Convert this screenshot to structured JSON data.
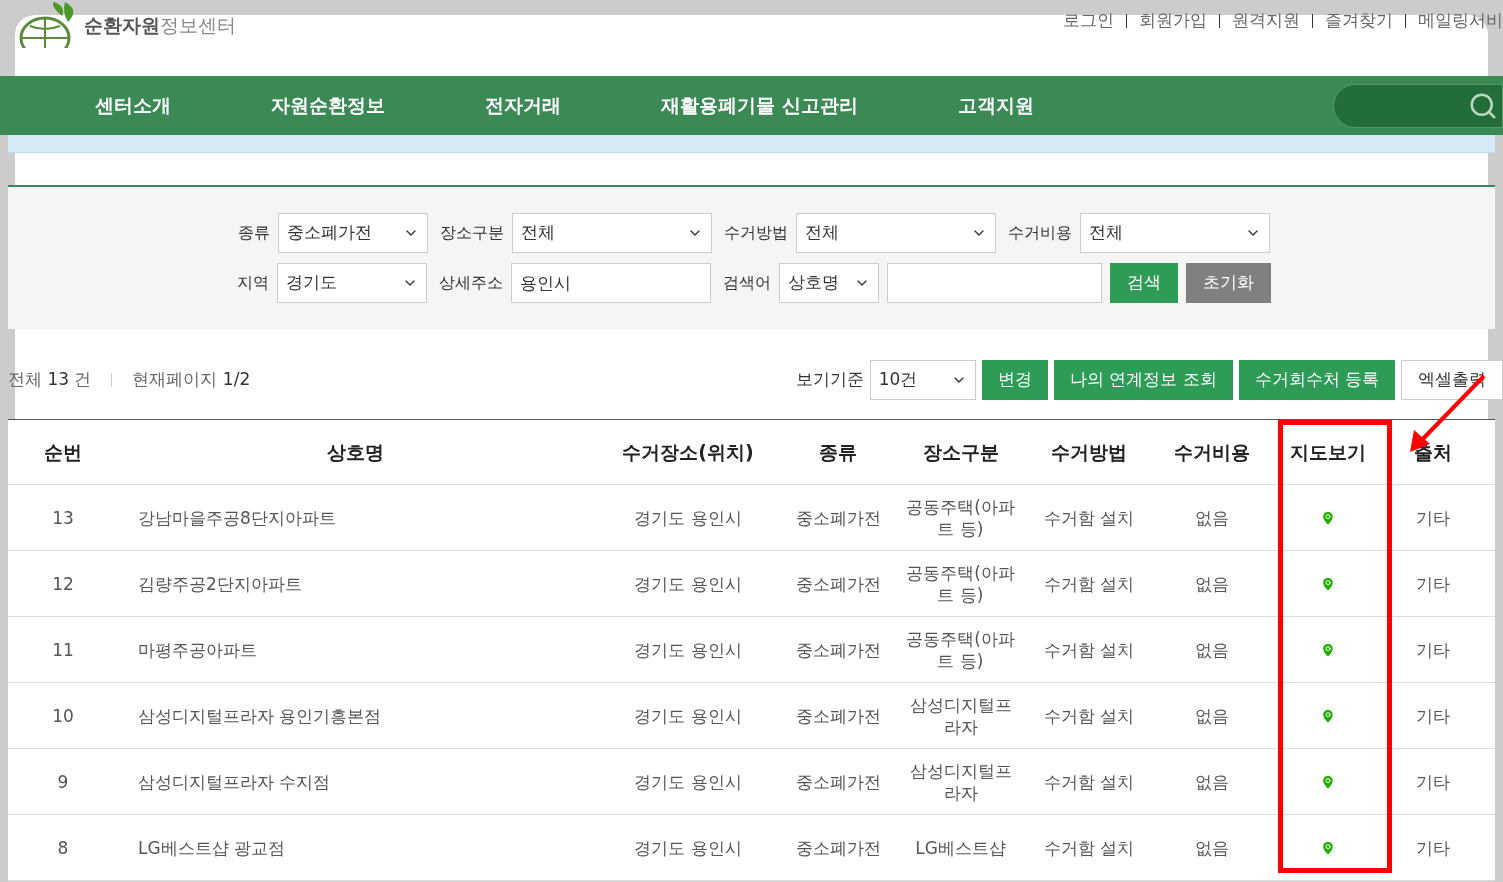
{
  "logo": {
    "text_bold": "순환자원",
    "text_light": "정보센터"
  },
  "top_links": [
    "로그인",
    "회원가입",
    "원격지원",
    "즐겨찾기",
    "메일링서비"
  ],
  "nav": {
    "items": [
      "센터소개",
      "자원순환정보",
      "전자거래",
      "재활용폐기물 신고관리",
      "고객지원"
    ]
  },
  "filters": {
    "row_1": [
      {
        "kind": "select",
        "label": "종류",
        "value": "중소폐가전"
      },
      {
        "kind": "select",
        "label": "장소구분",
        "value": "전체"
      },
      {
        "kind": "select",
        "label": "수거방법",
        "value": "전체"
      },
      {
        "kind": "select",
        "label": "수거비용",
        "value": "전체"
      }
    ],
    "row_2": [
      {
        "kind": "select",
        "label": "지역",
        "value": "경기도"
      },
      {
        "kind": "input",
        "label": "상세주소",
        "value": "용인시"
      },
      {
        "kind": "select",
        "label": "검색어",
        "value": "상호명"
      },
      {
        "kind": "input"
      }
    ],
    "buttons": [
      {
        "label": "검색",
        "kind": "primary"
      },
      {
        "label": "초기화",
        "kind": "secondary"
      }
    ]
  },
  "summary": {
    "total_label": "전체",
    "total": "13",
    "total_unit": "건",
    "page_label": "현재페이지",
    "page": "1/2"
  },
  "toolbar": {
    "view_label": "보기기준",
    "view_value": "10건",
    "buttons": [
      {
        "label": "변경",
        "kind": "primary"
      },
      {
        "label": "나의 연계정보 조회",
        "kind": "primary"
      },
      {
        "label": "수거회수처 등록",
        "kind": "primary"
      },
      {
        "label": "엑셀출력",
        "kind": "outline"
      }
    ]
  },
  "table": {
    "columns": [
      "순번",
      "상호명",
      "수거장소(위치)",
      "종류",
      "장소구분",
      "수거방법",
      "수거비용",
      "지도보기",
      "출처"
    ],
    "rows": [
      {
        "no": "13",
        "name": "강남마을주공8단지아파트",
        "location": "경기도 용인시",
        "type": "중소폐가전",
        "place": "공동주택(아파트 등)",
        "method": "수거함 설치",
        "cost": "없음",
        "source": "기타"
      },
      {
        "no": "12",
        "name": "김량주공2단지아파트",
        "location": "경기도 용인시",
        "type": "중소폐가전",
        "place": "공동주택(아파트 등)",
        "method": "수거함 설치",
        "cost": "없음",
        "source": "기타"
      },
      {
        "no": "11",
        "name": "마평주공아파트",
        "location": "경기도 용인시",
        "type": "중소폐가전",
        "place": "공동주택(아파트 등)",
        "method": "수거함 설치",
        "cost": "없음",
        "source": "기타"
      },
      {
        "no": "10",
        "name": "삼성디지털프라자 용인기흥본점",
        "location": "경기도 용인시",
        "type": "중소폐가전",
        "place": "삼성디지털프라자",
        "method": "수거함 설치",
        "cost": "없음",
        "source": "기타"
      },
      {
        "no": "9",
        "name": "삼성디지털프라자 수지점",
        "location": "경기도 용인시",
        "type": "중소폐가전",
        "place": "삼성디지털프라자",
        "method": "수거함 설치",
        "cost": "없음",
        "source": "기타"
      },
      {
        "no": "8",
        "name": "LG베스트샵 광교점",
        "location": "경기도 용인시",
        "type": "중소폐가전",
        "place": "LG베스트샵",
        "method": "수거함 설치",
        "cost": "없음",
        "source": "기타"
      }
    ]
  },
  "annotation": {
    "highlight_box": true,
    "arrow": true
  }
}
